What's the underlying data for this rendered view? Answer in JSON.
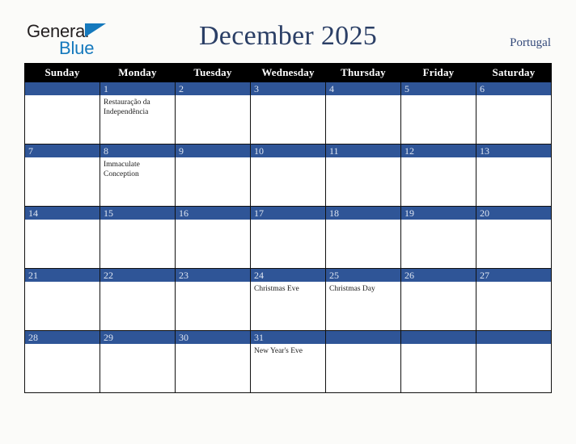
{
  "brand": {
    "name_part1": "General",
    "name_part2": "Blue",
    "triangle_icon": "triangle-icon",
    "accent_color": "#1579bd",
    "text_color": "#231f20"
  },
  "header": {
    "title": "December 2025",
    "region": "Portugal",
    "title_color": "#2b3f66",
    "region_color": "#33497a"
  },
  "calendar": {
    "month": "December",
    "year": "2025",
    "weekday_headers": [
      "Sunday",
      "Monday",
      "Tuesday",
      "Wednesday",
      "Thursday",
      "Friday",
      "Saturday"
    ],
    "header_bg": "#000000",
    "header_text": "#ffffff",
    "daybar_bg": "#2f5597",
    "daybar_text": "#dfe6f2",
    "cell_bg": "#ffffff",
    "border_color": "#111111",
    "weeks": [
      [
        {
          "day": "",
          "event": ""
        },
        {
          "day": "1",
          "event": "Restauração da Independência"
        },
        {
          "day": "2",
          "event": ""
        },
        {
          "day": "3",
          "event": ""
        },
        {
          "day": "4",
          "event": ""
        },
        {
          "day": "5",
          "event": ""
        },
        {
          "day": "6",
          "event": ""
        }
      ],
      [
        {
          "day": "7",
          "event": ""
        },
        {
          "day": "8",
          "event": "Immaculate Conception"
        },
        {
          "day": "9",
          "event": ""
        },
        {
          "day": "10",
          "event": ""
        },
        {
          "day": "11",
          "event": ""
        },
        {
          "day": "12",
          "event": ""
        },
        {
          "day": "13",
          "event": ""
        }
      ],
      [
        {
          "day": "14",
          "event": ""
        },
        {
          "day": "15",
          "event": ""
        },
        {
          "day": "16",
          "event": ""
        },
        {
          "day": "17",
          "event": ""
        },
        {
          "day": "18",
          "event": ""
        },
        {
          "day": "19",
          "event": ""
        },
        {
          "day": "20",
          "event": ""
        }
      ],
      [
        {
          "day": "21",
          "event": ""
        },
        {
          "day": "22",
          "event": ""
        },
        {
          "day": "23",
          "event": ""
        },
        {
          "day": "24",
          "event": "Christmas Eve"
        },
        {
          "day": "25",
          "event": "Christmas Day"
        },
        {
          "day": "26",
          "event": ""
        },
        {
          "day": "27",
          "event": ""
        }
      ],
      [
        {
          "day": "28",
          "event": ""
        },
        {
          "day": "29",
          "event": ""
        },
        {
          "day": "30",
          "event": ""
        },
        {
          "day": "31",
          "event": "New Year's Eve"
        },
        {
          "day": "",
          "event": ""
        },
        {
          "day": "",
          "event": ""
        },
        {
          "day": "",
          "event": ""
        }
      ]
    ]
  }
}
